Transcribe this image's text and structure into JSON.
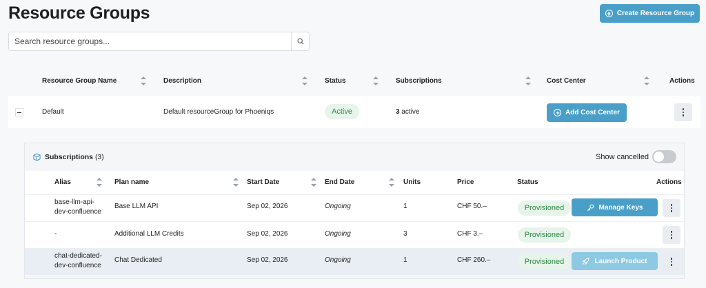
{
  "header": {
    "title": "Resource Groups",
    "create_button": "Create Resource Group"
  },
  "search": {
    "placeholder": "Search resource groups..."
  },
  "table": {
    "columns": [
      "Resource Group Name",
      "Description",
      "Status",
      "Subscriptions",
      "Cost Center",
      "Actions"
    ]
  },
  "group": {
    "name": "Default",
    "description": "Default resourceGroup for Phoeniqs",
    "status": "Active",
    "subscriptions_count": "3",
    "subscriptions_suffix": " active",
    "add_cost_center": "Add Cost Center"
  },
  "subscriptions": {
    "title": "Subscriptions",
    "count": "(3)",
    "show_cancelled": "Show cancelled",
    "show_cancelled_on": false,
    "columns": [
      "Alias",
      "Plan name",
      "Start Date",
      "End Date",
      "Units",
      "Price",
      "Status",
      "Actions"
    ],
    "rows": [
      {
        "alias_line1": "base-llm-api-",
        "alias_line2": "dev-confluence",
        "plan": "Base LLM API",
        "start": "Sep 02, 2026",
        "end": "Ongoing",
        "units": "1",
        "price": "CHF 50.–",
        "status": "Provisioned",
        "action": "Manage Keys"
      },
      {
        "alias_line1": "-",
        "alias_line2": "",
        "plan": "Additional LLM Credits",
        "start": "Sep 02, 2026",
        "end": "Ongoing",
        "units": "3",
        "price": "CHF 3.–",
        "status": "Provisioned",
        "action": ""
      },
      {
        "alias_line1": "chat-dedicated-",
        "alias_line2": "dev-confluence",
        "plan": "Chat Dedicated",
        "start": "Sep 02, 2026",
        "end": "Ongoing",
        "units": "1",
        "price": "CHF 260.–",
        "status": "Provisioned",
        "action": "Launch Product"
      }
    ]
  },
  "colors": {
    "accent": "#4a9fc9",
    "accent_light": "#8dc9e3",
    "success_bg": "#e6f4ea",
    "success_text": "#2f8a47"
  }
}
